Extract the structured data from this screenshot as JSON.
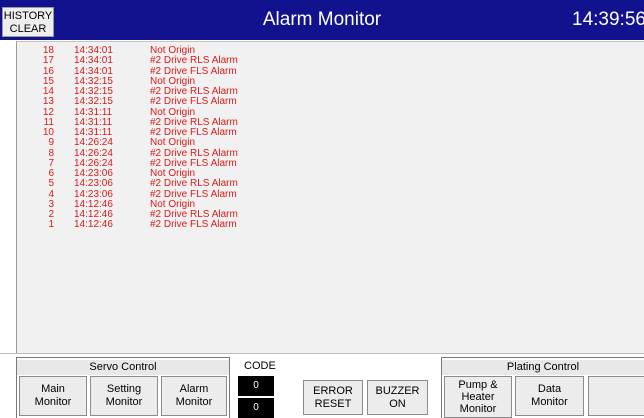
{
  "header": {
    "history_btn_line1": "HISTORY",
    "history_btn_line2": "CLEAR",
    "title": "Alarm Monitor",
    "clock": "14:39:56"
  },
  "alarms": [
    {
      "no": "18",
      "time": "14:34:01",
      "message": "Not Origin"
    },
    {
      "no": "17",
      "time": "14:34:01",
      "message": "#2 Drive  RLS Alarm"
    },
    {
      "no": "16",
      "time": "14:34:01",
      "message": "#2 Drive  FLS Alarm"
    },
    {
      "no": "15",
      "time": "14:32:15",
      "message": "Not Origin"
    },
    {
      "no": "14",
      "time": "14:32:15",
      "message": "#2 Drive  RLS Alarm"
    },
    {
      "no": "13",
      "time": "14:32:15",
      "message": "#2 Drive  FLS Alarm"
    },
    {
      "no": "12",
      "time": "14:31:11",
      "message": "Not Origin"
    },
    {
      "no": "11",
      "time": "14:31:11",
      "message": "#2 Drive  RLS Alarm"
    },
    {
      "no": "10",
      "time": "14:31:11",
      "message": "#2 Drive  FLS Alarm"
    },
    {
      "no": "9",
      "time": "14:26:24",
      "message": "Not Origin"
    },
    {
      "no": "8",
      "time": "14:26:24",
      "message": "#2 Drive  RLS Alarm"
    },
    {
      "no": "7",
      "time": "14:26:24",
      "message": "#2 Drive  FLS Alarm"
    },
    {
      "no": "6",
      "time": "14:23:06",
      "message": "Not Origin"
    },
    {
      "no": "5",
      "time": "14:23:06",
      "message": "#2 Drive  RLS Alarm"
    },
    {
      "no": "4",
      "time": "14:23:06",
      "message": "#2 Drive  FLS Alarm"
    },
    {
      "no": "3",
      "time": "14:12:46",
      "message": "Not Origin"
    },
    {
      "no": "2",
      "time": "14:12:46",
      "message": "#2 Drive  RLS Alarm"
    },
    {
      "no": "1",
      "time": "14:12:46",
      "message": "#2 Drive  FLS Alarm"
    }
  ],
  "servo": {
    "title": "Servo Control",
    "main_monitor": [
      "Main",
      "Monitor"
    ],
    "setting_monitor": [
      "Setting",
      "Monitor"
    ],
    "alarm_monitor": [
      "Alarm",
      "Monitor"
    ]
  },
  "code": {
    "label": "CODE",
    "value1": "0",
    "value2": "0"
  },
  "error_reset": [
    "ERROR",
    "RESET"
  ],
  "buzzer": [
    "BUZZER",
    "ON"
  ],
  "plating": {
    "title": "Plating Control",
    "pump_heater_monitor": [
      "Pump &",
      "Heater",
      "Monitor"
    ],
    "data_monitor": [
      "Data",
      "Monitor"
    ],
    "blank_button": ""
  },
  "colors": {
    "header_bg": "#12128e",
    "alarm_text": "#e11818",
    "panel_bg": "#f1f1f1"
  }
}
